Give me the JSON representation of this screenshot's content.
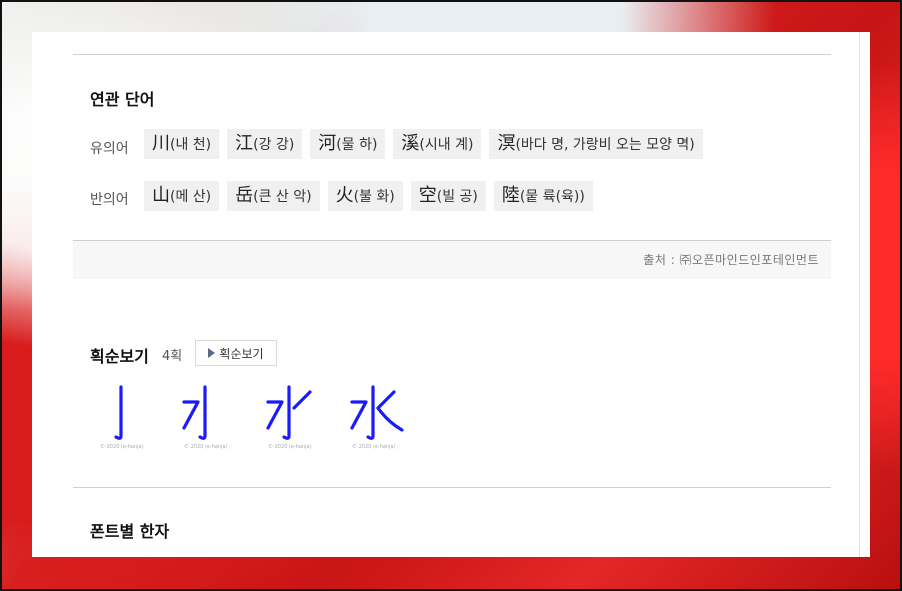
{
  "related": {
    "title": "연관 단어",
    "synonyms": {
      "label": "유의어",
      "items": [
        {
          "hanja": "川",
          "reading": "(내 천)"
        },
        {
          "hanja": "江",
          "reading": "(강 강)"
        },
        {
          "hanja": "河",
          "reading": "(물 하)"
        },
        {
          "hanja": "溪",
          "reading": "(시내 계)"
        },
        {
          "hanja": "溟",
          "reading": "(바다 명, 가랑비 오는 모양 멱)"
        }
      ]
    },
    "antonyms": {
      "label": "반의어",
      "items": [
        {
          "hanja": "山",
          "reading": "(메 산)"
        },
        {
          "hanja": "岳",
          "reading": "(큰 산 악)"
        },
        {
          "hanja": "火",
          "reading": "(불 화)"
        },
        {
          "hanja": "空",
          "reading": "(빌 공)"
        },
        {
          "hanja": "陸",
          "reading": "(뭍 륙(육))"
        }
      ]
    },
    "source": "출처 : ㈜오픈마인드인포테인먼트"
  },
  "stroke": {
    "title": "획순보기",
    "count": "4획",
    "button_label": "획순보기",
    "frame_copyright": "© 2020 (e-hanja)",
    "stroke_color": "#1a1aff"
  },
  "fonts": {
    "title": "폰트별 한자"
  }
}
